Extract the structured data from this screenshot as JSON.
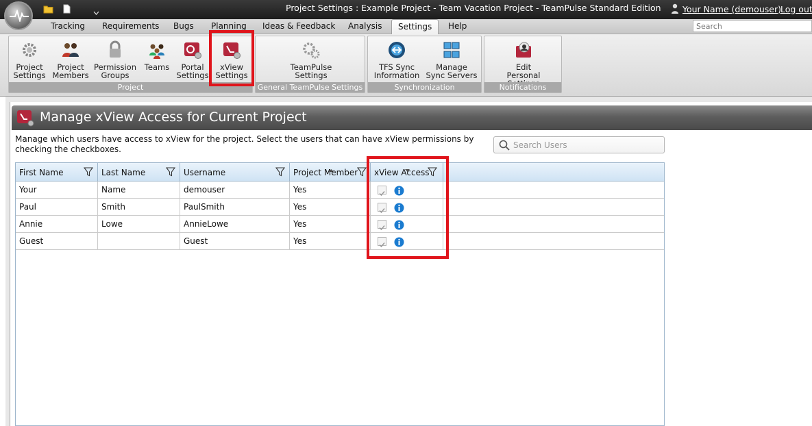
{
  "window": {
    "title": "Project Settings : Example Project - Team Vacation Project  - TeamPulse Standard Edition",
    "user_link": "Your Name (demouser)",
    "logout": "Log out"
  },
  "tabs": [
    "Tracking",
    "Requirements",
    "Bugs",
    "Planning",
    "Ideas & Feedback",
    "Analysis",
    "Settings",
    "Help"
  ],
  "active_tab": "Settings",
  "search": {
    "placeholder": "Search"
  },
  "ribbon": {
    "project": {
      "label": "Project",
      "buttons": [
        "Project\nSettings",
        "Project\nMembers",
        "Permission\nGroups",
        "Teams",
        "Portal\nSettings",
        "xView\nSettings"
      ]
    },
    "general": {
      "label": "General TeamPulse Settings",
      "buttons": [
        "TeamPulse\nSettings"
      ]
    },
    "sync": {
      "label": "Synchronization",
      "buttons": [
        "TFS Sync\nInformation",
        "Manage\nSync Servers"
      ]
    },
    "notifications": {
      "label": "Notifications",
      "buttons": [
        "Edit\nPersonal Settings"
      ]
    }
  },
  "panel": {
    "title": "Manage xView Access for Current Project",
    "description": "Manage which users have access to xView for the project. Select the users that can have xView permissions by checking the checkboxes.",
    "search_placeholder": "Search Users"
  },
  "grid": {
    "columns": [
      "First Name",
      "Last Name",
      "Username",
      "Project Member",
      "xView Access"
    ],
    "rows": [
      {
        "first": "Your",
        "last": "Name",
        "username": "demouser",
        "member": "Yes",
        "xview": true
      },
      {
        "first": "Paul",
        "last": "Smith",
        "username": "PaulSmith",
        "member": "Yes",
        "xview": true
      },
      {
        "first": "Annie",
        "last": "Lowe",
        "username": "AnnieLowe",
        "member": "Yes",
        "xview": true
      },
      {
        "first": "Guest",
        "last": "",
        "username": "Guest",
        "member": "Yes",
        "xview": true
      }
    ]
  },
  "colors": {
    "highlight": "#e0141b",
    "title_bar": "#2a2a2a",
    "grid_header": "#d6e7f6",
    "info_icon": "#1a7bd0"
  },
  "icons": [
    "app-orb-icon",
    "folder-icon",
    "new-document-icon",
    "dropdown-icon",
    "user-icon",
    "gear-icon",
    "members-icon",
    "lock-icon",
    "teams-icon",
    "portal-settings-icon",
    "xview-settings-icon",
    "teampulse-settings-icon",
    "tfs-sync-icon",
    "sync-servers-icon",
    "personal-settings-icon",
    "search-icon",
    "filter-icon",
    "sort-icon",
    "info-icon",
    "checkbox"
  ]
}
